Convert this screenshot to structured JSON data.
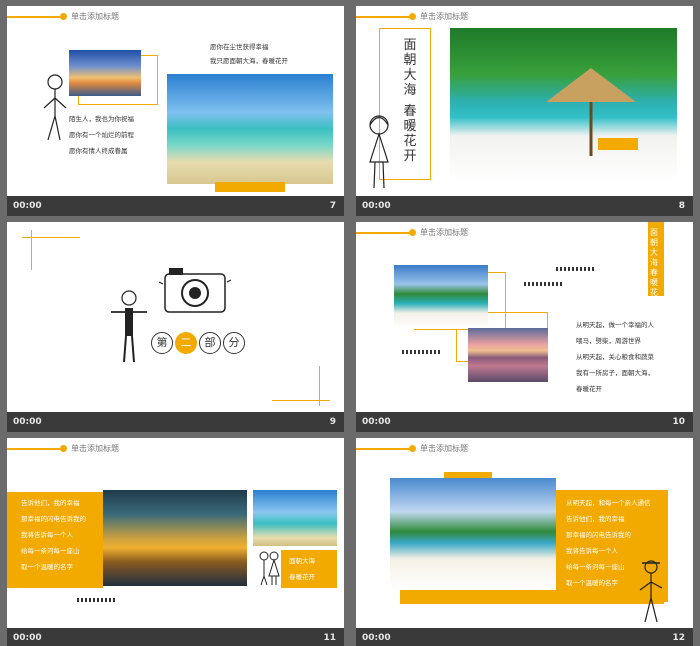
{
  "colors": {
    "accent": "#f2a900",
    "footer": "#3a3a3a"
  },
  "header_title": "单击添加标题",
  "slides": [
    {
      "num": "7",
      "time": "00:00",
      "lines_top": [
        "愿你在尘世获得幸福",
        "我只愿面朝大海，春暖花开"
      ],
      "lines_left": [
        "陌生人，我也为你祝福",
        "愿你有一个灿烂的前程",
        "愿你有情人终成眷属"
      ]
    },
    {
      "num": "8",
      "time": "00:00",
      "vcol1": "面朝大海",
      "vcol2": "春暖花开"
    },
    {
      "num": "9",
      "time": "00:00",
      "chars": [
        "第",
        "二",
        "部",
        "分"
      ]
    },
    {
      "num": "10",
      "time": "00:00",
      "vtitle": "面朝大海春暖花开",
      "lines": [
        "从明天起，做一个幸福的人",
        "喂马，劈柴，周游世界",
        "从明天起，关心粮食和蔬菜",
        "我有一所房子，面朝大海，",
        "春暖花开"
      ]
    },
    {
      "num": "11",
      "time": "00:00",
      "lines": [
        "告诉他们，我的幸福",
        "那幸福的闪电告诉我的",
        "我将告诉每一个人",
        "给每一条河每一座山",
        "取一个温暖的名字"
      ],
      "tag": [
        "面朝大海",
        "春暖花开"
      ]
    },
    {
      "num": "12",
      "time": "00:00",
      "lines": [
        "从明天起，和每一个亲人通信",
        "告诉他们，我的幸福",
        "那幸福的闪电告诉我的",
        "我将告诉每一个人",
        "给每一条河每一座山",
        "取一个温暖的名字"
      ]
    }
  ]
}
